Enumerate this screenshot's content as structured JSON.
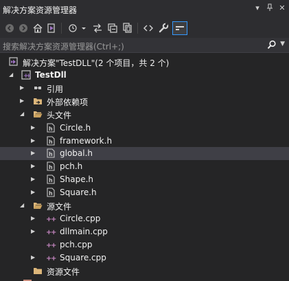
{
  "window": {
    "title": "解决方案资源管理器",
    "controls": [
      "▾",
      "ᛜ",
      "✕"
    ]
  },
  "search": {
    "placeholder": "搜索解决方案资源管理器(Ctrl+;)"
  },
  "tree": {
    "solution": "解决方案\"TestDLL\"(2 个项目，共 2 个)",
    "project": "TestDll",
    "references": "引用",
    "external_deps": "外部依赖项",
    "header_folder": "头文件",
    "headers": [
      "Circle.h",
      "framework.h",
      "global.h",
      "pch.h",
      "Shape.h",
      "Square.h"
    ],
    "source_folder": "源文件",
    "sources": [
      "Circle.cpp",
      "dllmain.cpp",
      "pch.cpp",
      "Square.cpp"
    ],
    "resource_folder": "资源文件",
    "selected": "global.h"
  },
  "colors": {
    "background": "#252526",
    "selection": "#3f3f46",
    "accent": "#3399ff",
    "folder": "#dcb67a",
    "vs_purple": "#a074c4",
    "cpp_icon": "#c586c0"
  }
}
